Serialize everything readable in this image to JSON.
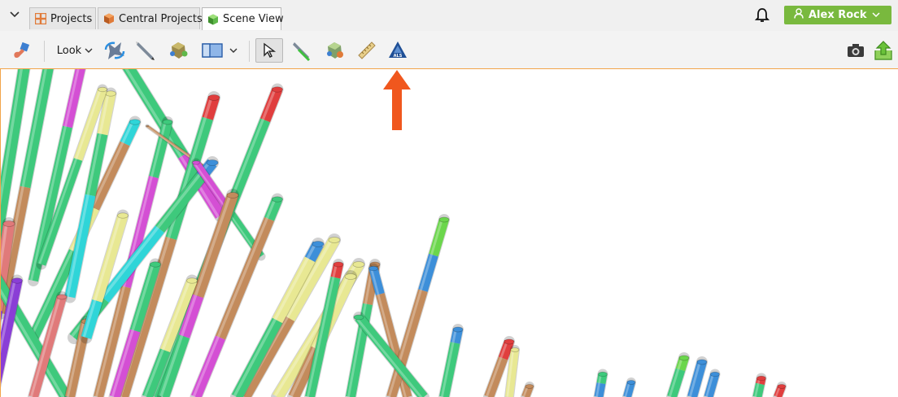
{
  "tabs": {
    "items": [
      {
        "label": "Projects",
        "icon": "projects-grid-icon"
      },
      {
        "label": "Central Projects",
        "icon": "central-projects-icon"
      },
      {
        "label": "Scene View",
        "icon": "scene-cube-icon",
        "active": true
      }
    ]
  },
  "header": {
    "user_name": "Alex Rock",
    "accent_color": "#79b93e"
  },
  "toolbar": {
    "look_label": "Look",
    "tools": [
      "hand-tool-icon",
      "look-dropdown",
      "rotate-sync-icon",
      "pencil-icon",
      "shape-tool-icon",
      "panel-layout-icon",
      "select-pointer-icon",
      "draw-line-icon",
      "move-shape-icon",
      "ruler-icon",
      "als-logo-icon",
      "camera-icon",
      "share-upload-icon"
    ],
    "highlight_color": "#f2a44a"
  },
  "annotation": {
    "arrow_color": "#f0571e",
    "target": "als-logo-icon"
  },
  "scene": {
    "segment_colors": [
      "#3ec97c",
      "#c38b5c",
      "#e8e893",
      "#d44fd4",
      "#2fd5d8",
      "#e03e3e",
      "#3d8fd9",
      "#8a3ed6",
      "#6bd64c",
      "#e07a7a"
    ],
    "background": "#ffffff"
  }
}
